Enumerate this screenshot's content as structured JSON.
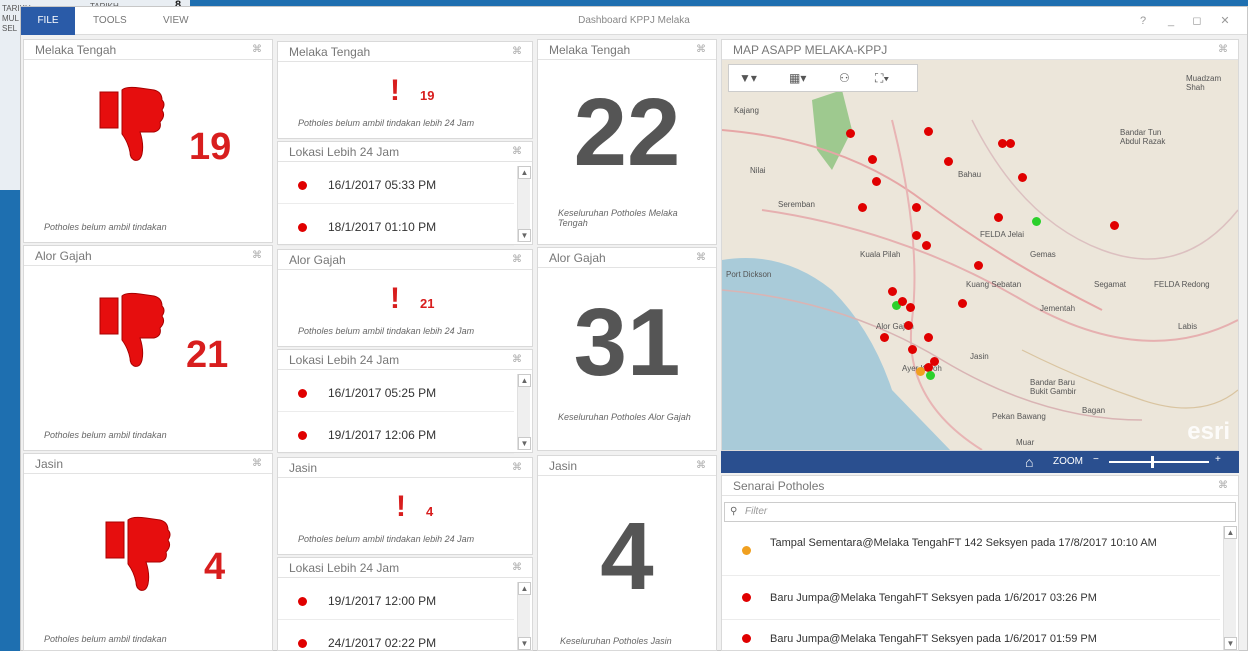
{
  "desktop": {
    "line1": "TARIKH",
    "line2": "MUL",
    "line3": "SEL",
    "right": "TARIKH",
    "num": "8"
  },
  "app": {
    "title": "Dashboard KPPJ Melaka",
    "menu_file": "FILE",
    "menu_tools": "TOOLS",
    "menu_view": "VIEW",
    "help": "?",
    "minimize": "_",
    "restore": "◻",
    "close": "✕"
  },
  "accent": "#d81e1e",
  "pin_glyph": "⌘",
  "zones": [
    {
      "name": "Melaka Tengah",
      "count": "19",
      "caption": "Potholes belum ambil tindakan",
      "alert_count": "19",
      "alert_caption": "Potholes belum ambil tindakan lebih 24 Jam",
      "list_title": "Lokasi Lebih 24 Jam",
      "list": [
        "16/1/2017 05:33 PM",
        "18/1/2017 01:10 PM"
      ],
      "total": "22",
      "total_caption": "Keseluruhan Potholes Melaka Tengah"
    },
    {
      "name": "Alor Gajah",
      "count": "21",
      "caption": "Potholes belum ambil tindakan",
      "alert_count": "21",
      "alert_caption": "Potholes belum ambil tindakan lebih 24 Jam",
      "list_title": "Lokasi Lebih 24 Jam",
      "list": [
        "16/1/2017 05:25 PM",
        "19/1/2017 12:06 PM"
      ],
      "total": "31",
      "total_caption": "Keseluruhan Potholes Alor Gajah"
    },
    {
      "name": "Jasin",
      "count": "4",
      "caption": "Potholes belum ambil tindakan",
      "alert_count": "4",
      "alert_caption": "Potholes belum ambil tindakan lebih 24 Jam",
      "list_title": "Lokasi Lebih 24 Jam",
      "list": [
        "19/1/2017 12:00 PM",
        "24/1/2017 02:22 PM"
      ],
      "total": "4",
      "total_caption": "Keseluruhan Potholes Jasin"
    }
  ],
  "map": {
    "title": "MAP ASAPP MELAKA-KPPJ",
    "labels": [
      "Kajang",
      "Nilai",
      "Seremban",
      "Port Dickson",
      "Bahau",
      "FELDA Jelai",
      "Kuala Pilah",
      "Gemas",
      "Segamat",
      "Alor Gajah",
      "Jasin",
      "Muadzam Shah",
      "Bandar Tun Abdul Razak",
      "FELDA Redong",
      "Labis",
      "Bandar Baru Bukit Gambir",
      "Bagan",
      "Pekan Bawang",
      "Muar",
      "Kuang Sebatan",
      "Jementah",
      "Ayer Keroh"
    ],
    "logo": "esri",
    "zoom_label": "ZOOM",
    "home_glyph": "⌂"
  },
  "senarai": {
    "title": "Senarai Potholes",
    "filter_placeholder": "Filter",
    "items": [
      {
        "text": "Tampal Sementara@Melaka TengahFT 142 Seksyen  pada 17/8/2017 10:10 AM",
        "color": "#f0a020"
      },
      {
        "text": "Baru Jumpa@Melaka TengahFT  Seksyen  pada 1/6/2017 03:26 PM",
        "color": "#e00000"
      },
      {
        "text": "Baru Jumpa@Melaka TengahFT  Seksyen  pada 1/6/2017 01:59 PM",
        "color": "#e00000"
      }
    ]
  }
}
